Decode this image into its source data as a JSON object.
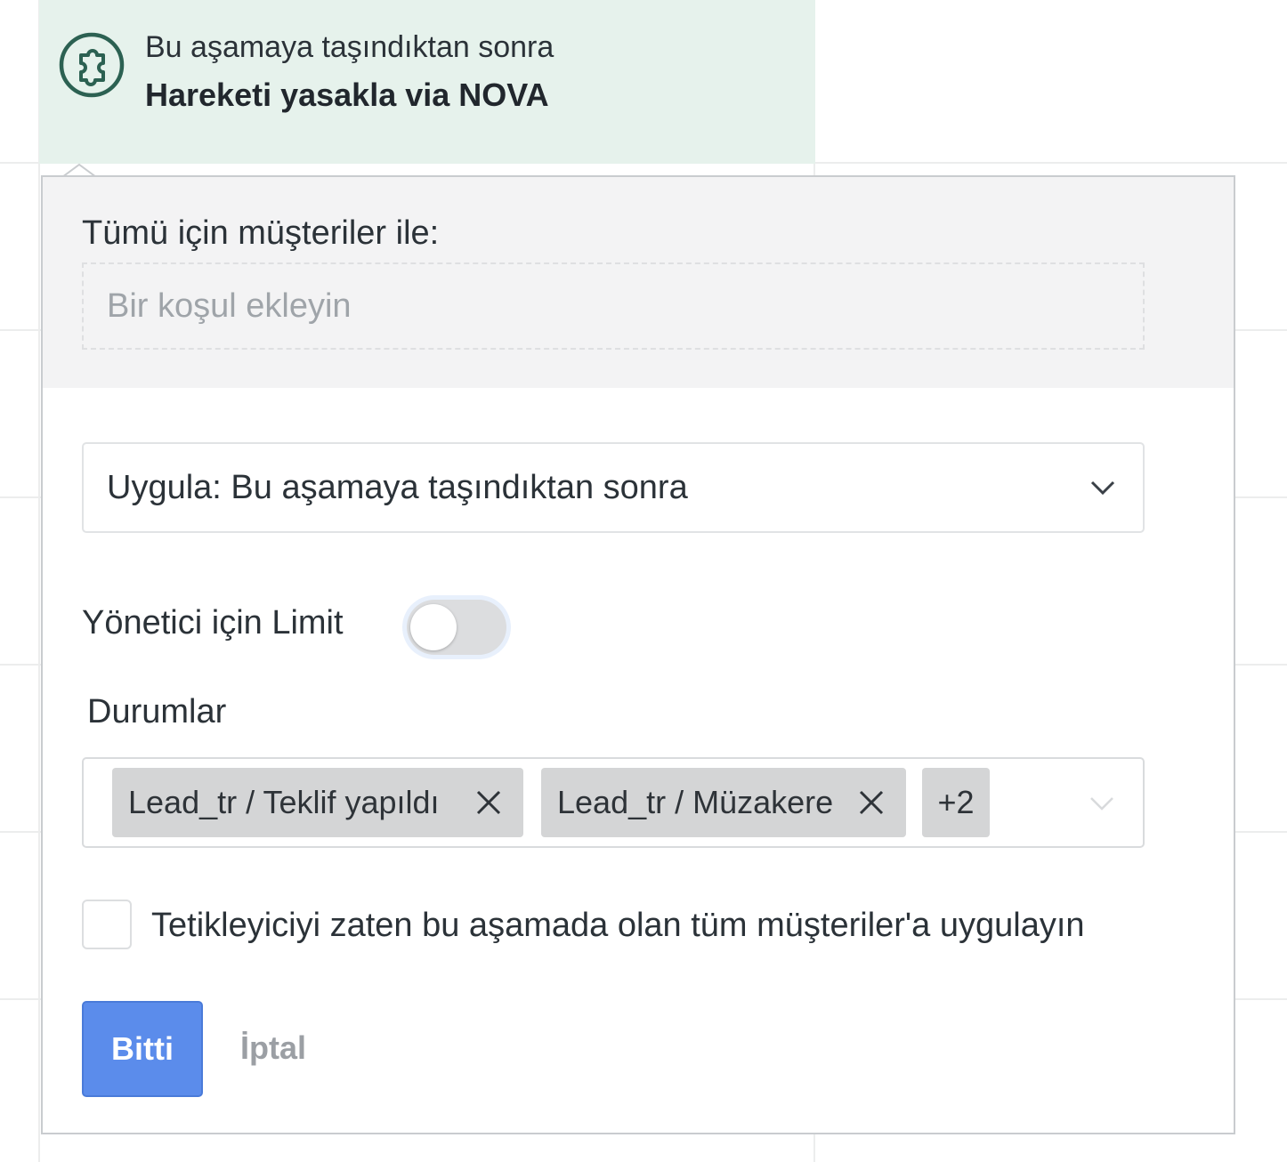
{
  "trigger": {
    "icon": "puzzle-icon",
    "subtitle": "Bu aşamaya taşındıktan sonra",
    "title": "Hareketi yasakla via NOVA"
  },
  "popup": {
    "clients_label": "Tümü için müşteriler ile:",
    "condition_placeholder": "Bir koşul ekleyin",
    "apply_select": {
      "value": "Uygula: Bu aşamaya taşındıktan sonra",
      "icon": "chevron-down-icon"
    },
    "manager_limit": {
      "label": "Yönetici için Limit",
      "enabled": false
    },
    "statuses": {
      "label": "Durumlar",
      "chips": [
        {
          "label": "Lead_tr / Teklif yapıldı"
        },
        {
          "label": "Lead_tr / Müzakere"
        }
      ],
      "more_count": "+2"
    },
    "apply_existing": {
      "checked": false,
      "label": "Tetikleyiciyi zaten bu aşamada olan tüm müşteriler'a uygulayın"
    },
    "buttons": {
      "done": "Bitti",
      "cancel": "İptal"
    }
  },
  "colors": {
    "trigger_bg": "#e6f2ec",
    "trigger_icon": "#2c6152",
    "primary_button": "#5b8ceb",
    "chip_bg": "#d4d5d6",
    "muted_text": "#9b9fa4"
  }
}
